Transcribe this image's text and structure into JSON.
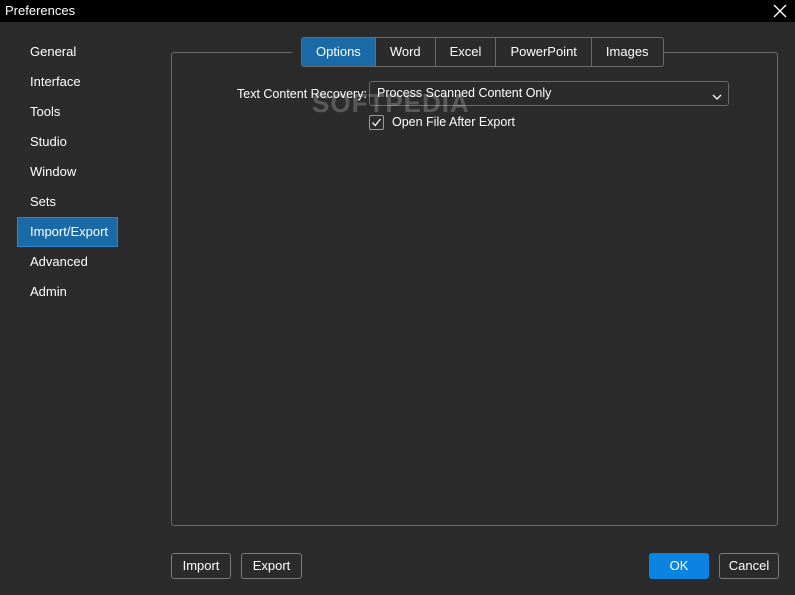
{
  "window": {
    "title": "Preferences",
    "close_icon": "close-icon"
  },
  "sidebar": {
    "items": [
      {
        "label": "General"
      },
      {
        "label": "Interface"
      },
      {
        "label": "Tools"
      },
      {
        "label": "Studio"
      },
      {
        "label": "Window"
      },
      {
        "label": "Sets"
      },
      {
        "label": "Import/Export",
        "active": true
      },
      {
        "label": "Advanced"
      },
      {
        "label": "Admin"
      }
    ]
  },
  "tabs": [
    {
      "label": "Options",
      "active": true
    },
    {
      "label": "Word"
    },
    {
      "label": "Excel"
    },
    {
      "label": "PowerPoint"
    },
    {
      "label": "Images"
    }
  ],
  "options": {
    "text_content_recovery_label": "Text Content Recovery:",
    "text_content_recovery_value": "Process Scanned Content Only",
    "open_file_after_export_label": "Open File After Export",
    "open_file_after_export_checked": true
  },
  "watermark": "SOFTPEDIA",
  "footer": {
    "import_label": "Import",
    "export_label": "Export",
    "ok_label": "OK",
    "cancel_label": "Cancel"
  },
  "colors": {
    "background": "#2b2b2b",
    "titlebar": "#000000",
    "accent": "#1a6aa8",
    "primary_button": "#0a84e0"
  }
}
